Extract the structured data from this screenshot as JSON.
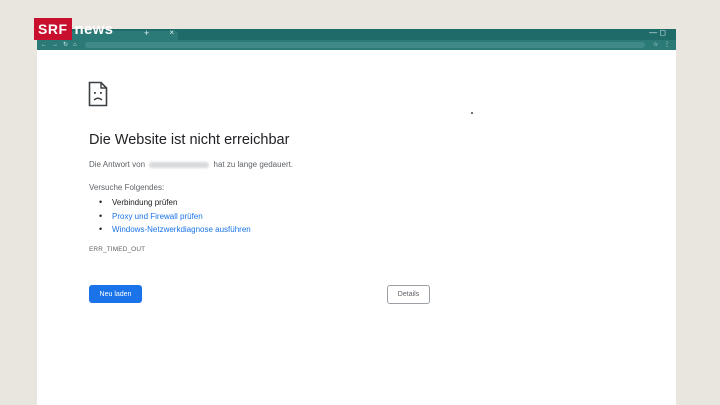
{
  "overlay": {
    "brand": "SRF",
    "brand_suffix": "news",
    "brand_color": "#c8102e"
  },
  "browser": {
    "chrome_color": "#1e6b6a",
    "tab_close": "×",
    "new_tab": "+",
    "window_controls": "—  ◻",
    "nav": [
      "←",
      "→",
      "↻",
      "⌂"
    ],
    "toolbar_right": [
      "☆",
      "⋮"
    ]
  },
  "error_page": {
    "icon": "sad-page-icon",
    "title": "Die Website ist nicht erreichbar",
    "response_prefix": "Die Antwort von",
    "response_suffix": "hat zu lange gedauert.",
    "try_heading": "Versuche Folgendes:",
    "tips": [
      {
        "label": "Verbindung prüfen",
        "link": false
      },
      {
        "label": "Proxy und Firewall prüfen",
        "link": true
      },
      {
        "label": "Windows-Netzwerkdiagnose ausführen",
        "link": true
      }
    ],
    "error_code": "ERR_TIMED_OUT",
    "reload_label": "Neu laden",
    "details_label": "Details",
    "accent": "#1a73e8"
  }
}
